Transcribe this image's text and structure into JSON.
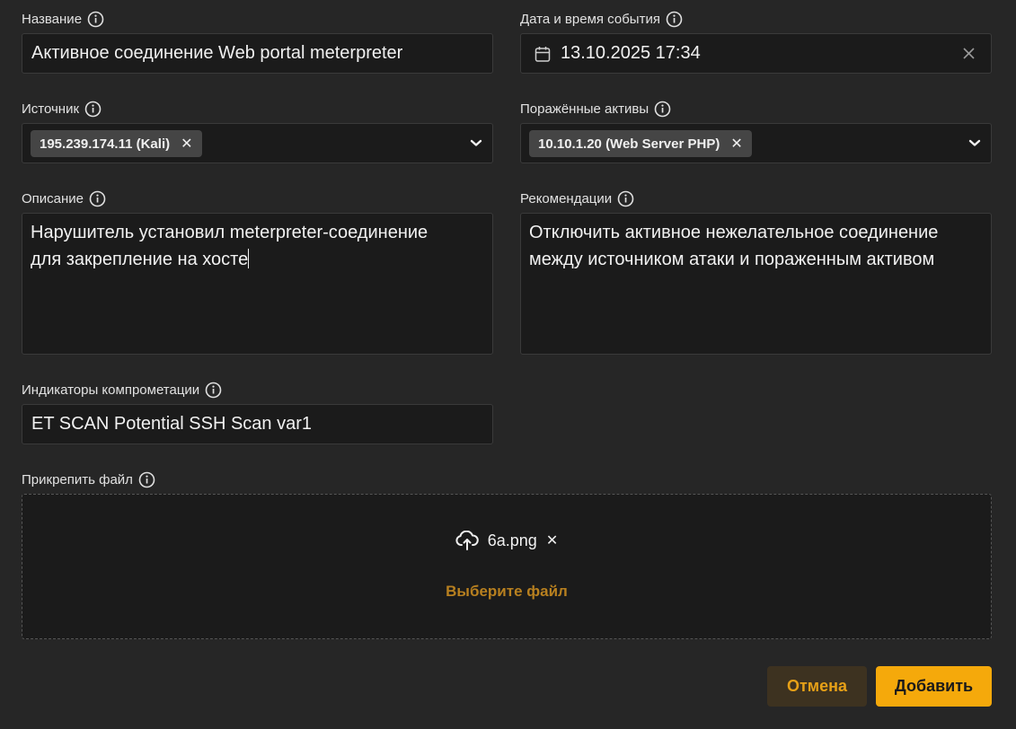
{
  "name": {
    "label": "Название",
    "value": "Активное соединение Web portal meterpreter"
  },
  "datetime": {
    "label": "Дата и время события",
    "value": "13.10.2025 17:34"
  },
  "source": {
    "label": "Источник",
    "tag": "195.239.174.11 (Kali)"
  },
  "assets": {
    "label": "Поражённые активы",
    "tag": "10.10.1.20 (Web Server PHP)"
  },
  "description": {
    "label": "Описание",
    "line1": "Нарушитель установил meterpreter-соединение",
    "line2": "для закрепление на хосте"
  },
  "recommendations": {
    "label": "Рекомендации",
    "line1": "Отключить активное нежелательное соединение",
    "line2": "между источником атаки и пораженным активом"
  },
  "ioc": {
    "label": "Индикаторы компрометации",
    "value": "ET SCAN Potential SSH Scan var1"
  },
  "attach": {
    "label": "Прикрепить файл",
    "file_name": "6a.png",
    "choose_label": "Выберите файл"
  },
  "actions": {
    "cancel_label": "Отмена",
    "add_label": "Добавить"
  },
  "colors": {
    "accent": "#f5a90b",
    "background": "#262626",
    "field_bg": "#1b1b1b"
  }
}
